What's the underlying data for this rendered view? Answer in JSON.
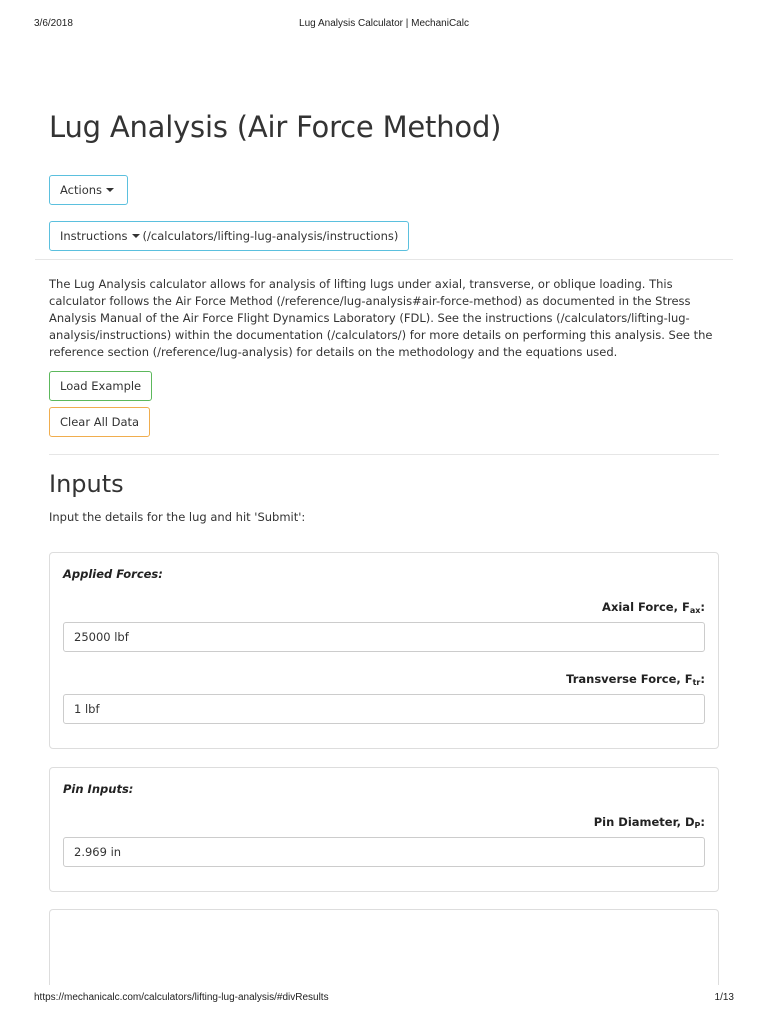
{
  "print_header": {
    "date": "3/6/2018",
    "title": "Lug Analysis Calculator | MechaniCalc"
  },
  "print_footer": {
    "url": "https://mechanicalc.com/calculators/lifting-lug-analysis/#divResults",
    "page": "1/13"
  },
  "page": {
    "title": "Lug Analysis (Air Force Method)",
    "actions_label": "Actions",
    "instructions_label": "Instructions",
    "instructions_link": "(/calculators/lifting-lug-analysis/instructions)",
    "intro": "The Lug Analysis calculator allows for analysis of lifting lugs under axial, transverse, or oblique loading. This calculator follows the Air Force Method (/reference/lug-analysis#air-force-method) as documented in the Stress Analysis Manual of the Air Force Flight Dynamics Laboratory (FDL). See the instructions (/calculators/lifting-lug-analysis/instructions) within the documentation (/calculators/) for more details on performing this analysis. See the reference section (/reference/lug-analysis) for details on the methodology and the equations used.",
    "load_example_label": "Load Example",
    "clear_all_label": "Clear All Data"
  },
  "inputs": {
    "title": "Inputs",
    "subtitle": "Input the details for the lug and hit 'Submit':",
    "applied_forces": {
      "heading": "Applied Forces:",
      "axial_label": "Axial Force, F",
      "axial_sub": "ax",
      "axial_value": "25000 lbf",
      "transverse_label": "Transverse Force, F",
      "transverse_sub": "tr",
      "transverse_value": "1 lbf"
    },
    "pin_inputs": {
      "heading": "Pin Inputs:",
      "diameter_label": "Pin Diameter, D",
      "diameter_sub": "P",
      "diameter_value": "2.969 in"
    }
  },
  "colors": {
    "info_border": "#5bc0de",
    "success_border": "#5cb85c",
    "warning_border": "#f0ad4e",
    "panel_border": "#dddddd"
  }
}
